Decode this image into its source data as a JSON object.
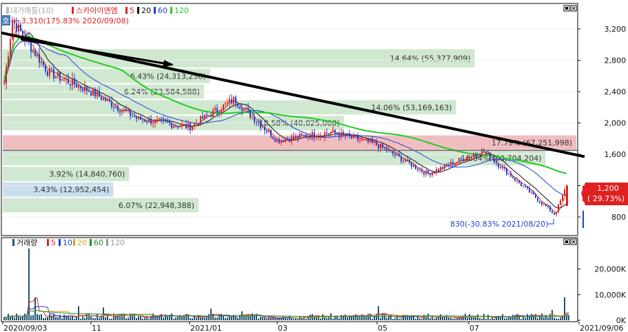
{
  "price_legend": {
    "title": "대가매틀(10)",
    "items": [
      {
        "label": "스카이이앤엠",
        "color": "#e02020"
      },
      {
        "label": "5",
        "color": "#e02020"
      },
      {
        "label": "20",
        "color": "#111111"
      },
      {
        "label": "60",
        "color": "#1f3fd0"
      },
      {
        "label": "120",
        "color": "#22cc22"
      }
    ]
  },
  "volume_legend": {
    "title": "거래량",
    "items": [
      {
        "label": "5",
        "color": "#e02020"
      },
      {
        "label": "10",
        "color": "#1f3fd0"
      },
      {
        "label": "20",
        "color": "#e0a020"
      },
      {
        "label": "60",
        "color": "#2a8a2a"
      },
      {
        "label": "120",
        "color": "#999999"
      }
    ]
  },
  "side_badge": "호",
  "high_annotation": "3,310(175.83% 2020/09/08)",
  "low_annotation": "830(-30.83% 2021/08/20)",
  "current_price": {
    "value": "1,200",
    "change": "( 29.73%)"
  },
  "price_axis": {
    "ticks": [
      "3,200",
      "2,800",
      "2,400",
      "2,000",
      "1,600",
      "1,200",
      "800"
    ]
  },
  "volume_axis": {
    "ticks": [
      "20,000K",
      "10,000K",
      "0K"
    ]
  },
  "date_axis": {
    "labels": [
      "2020/09/03",
      "11",
      "2021/01",
      "03",
      "05",
      "07",
      "2021/09/06"
    ]
  },
  "chart_data": {
    "type": "candlestick",
    "y_range": [
      570,
      3420
    ],
    "volume_range": [
      0,
      30000
    ],
    "volume_unit": "K",
    "volume_profile": [
      {
        "label": "14.64% (55,377,909)",
        "pct": 14.64,
        "from": 2700,
        "to": 2950
      },
      {
        "label": "6.43% (24,313,256)",
        "pct": 6.43,
        "from": 2500,
        "to": 2700
      },
      {
        "label": "6.24% (23,584,588)",
        "pct": 6.24,
        "from": 2300,
        "to": 2500
      },
      {
        "label": "14.06% (53,169,163)",
        "pct": 14.06,
        "from": 2100,
        "to": 2300
      },
      {
        "label": "10.58% (40,025,000)",
        "pct": 10.58,
        "from": 1900,
        "to": 2100
      },
      {
        "label": "17.79% (67,251,998)",
        "pct": 17.79,
        "from": 1650,
        "to": 1850
      },
      {
        "label": "16.84% (63,704,204)",
        "pct": 16.84,
        "from": 1450,
        "to": 1650
      },
      {
        "label": "3.92% (14,840,760)",
        "pct": 3.92,
        "from": 1250,
        "to": 1450
      },
      {
        "label": "3.43% (12,952,454)",
        "pct": 3.43,
        "from": 1050,
        "to": 1250
      },
      {
        "label": "6.07% (22,948,388)",
        "pct": 6.07,
        "from": 850,
        "to": 1050
      }
    ],
    "key_prices": [
      {
        "date": "2020/09/03",
        "close": 2500
      },
      {
        "date": "2020/09/08",
        "close": 3310
      },
      {
        "date": "2020/10",
        "close": 2650
      },
      {
        "date": "2020/11",
        "close": 2400
      },
      {
        "date": "2020/12",
        "close": 2050
      },
      {
        "date": "2021/01",
        "close": 1950
      },
      {
        "date": "2021/02",
        "close": 2300
      },
      {
        "date": "2021/03",
        "close": 1780
      },
      {
        "date": "2021/04",
        "close": 1880
      },
      {
        "date": "2021/05",
        "close": 1720
      },
      {
        "date": "2021/06",
        "close": 1350
      },
      {
        "date": "2021/07",
        "close": 1650
      },
      {
        "date": "2021/08/20",
        "close": 830
      },
      {
        "date": "2021/09/06",
        "close": 1200
      }
    ],
    "trendline": {
      "from": {
        "date": "2020/09/03",
        "value": 3150
      },
      "to": {
        "date": "2021/09/06",
        "value": 1570
      }
    },
    "support_line": 1650
  }
}
